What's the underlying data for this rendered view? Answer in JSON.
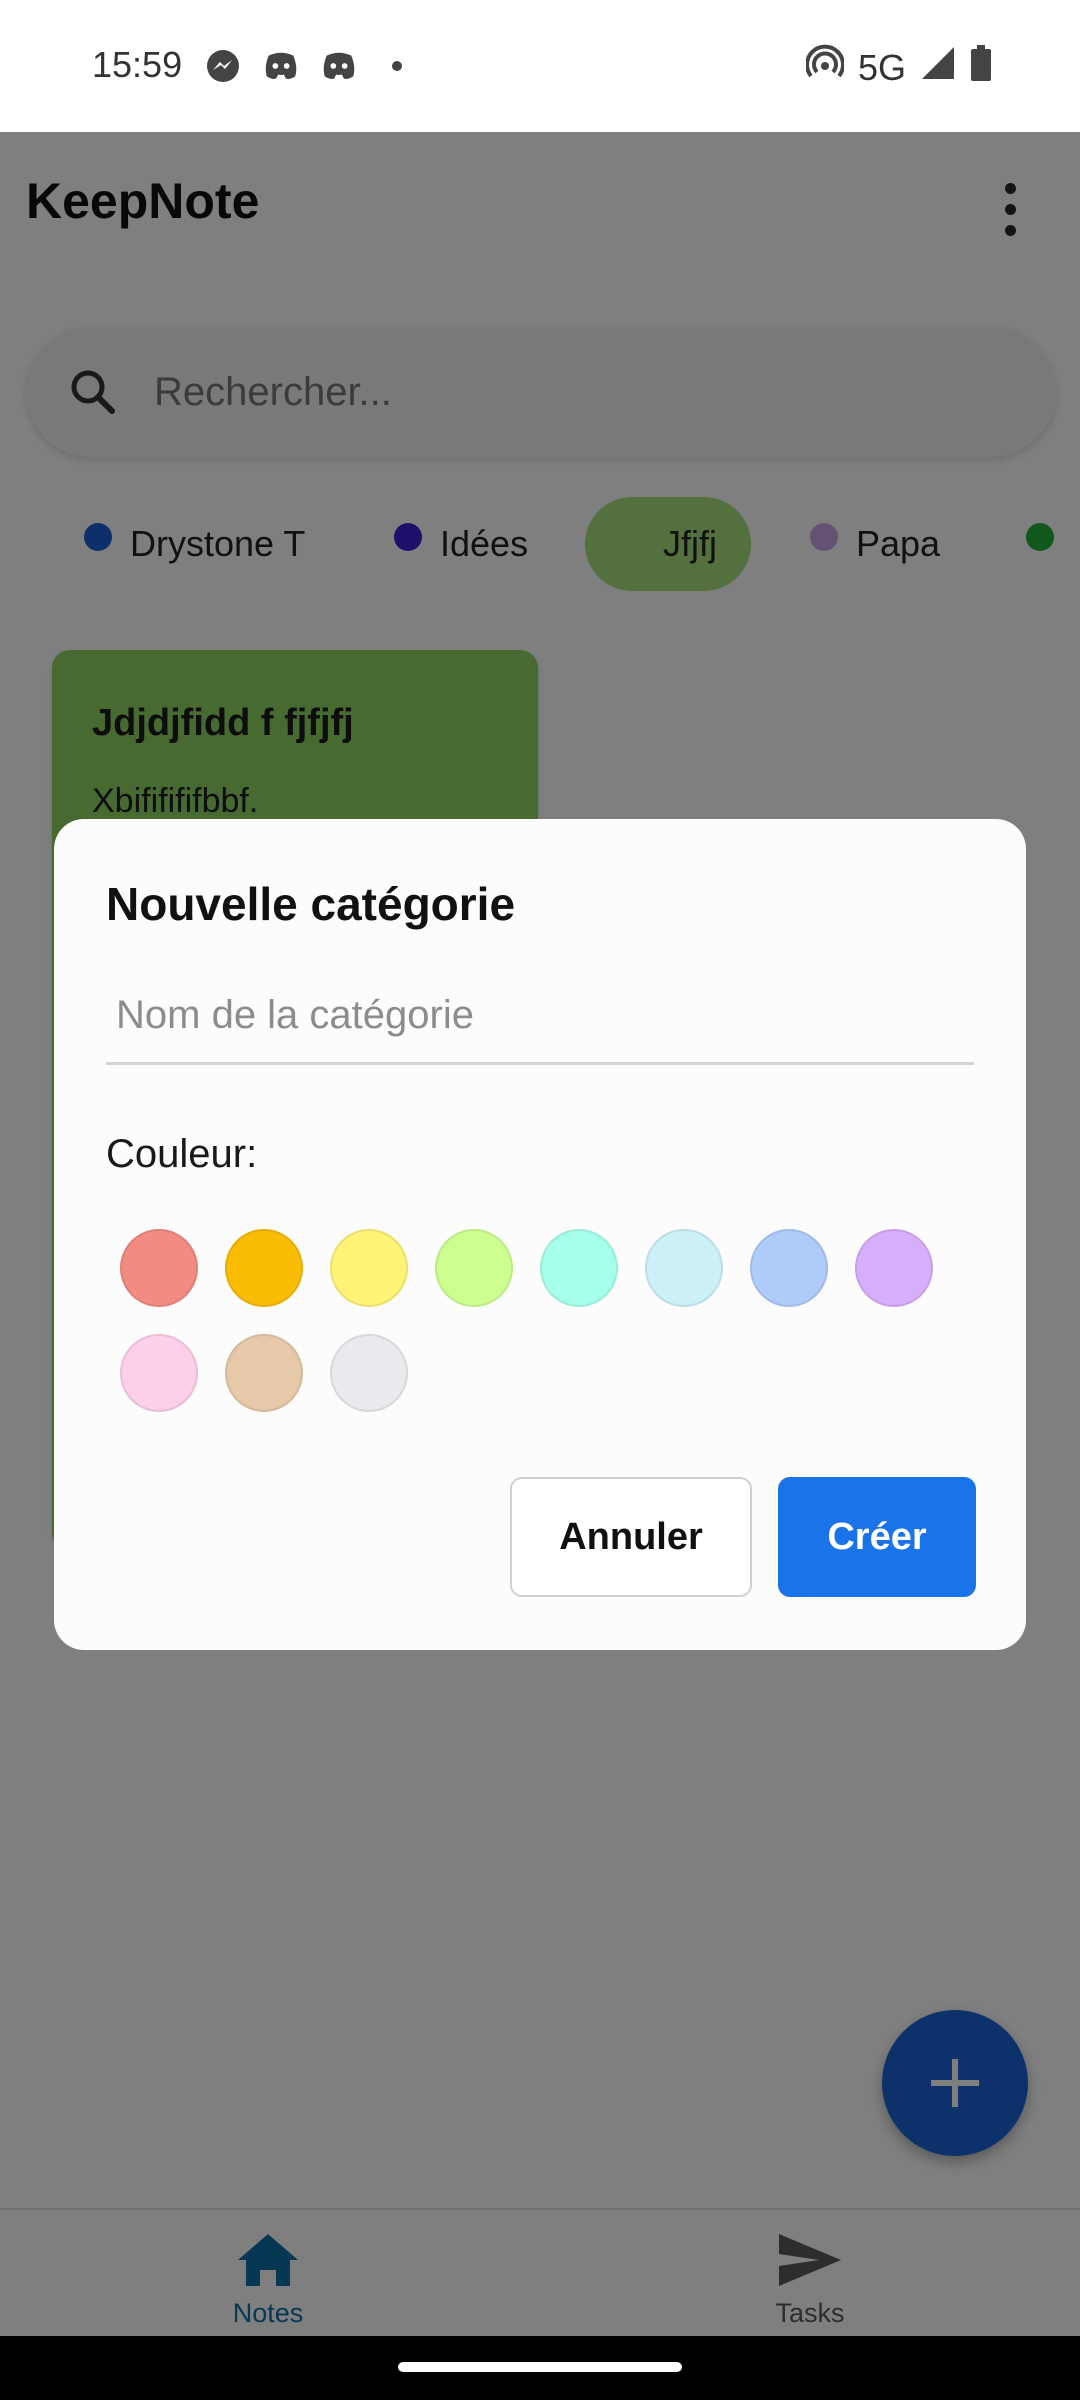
{
  "status_bar": {
    "time": "15:59",
    "network": "5G",
    "icons_left": [
      "messenger-icon",
      "discord-icon",
      "discord-icon",
      "dot-icon"
    ],
    "icons_right": [
      "hotspot-icon",
      "signal-icon",
      "battery-icon"
    ]
  },
  "app": {
    "title": "KeepNote",
    "search_placeholder": "Rechercher...",
    "categories": [
      {
        "label": "Drystone T",
        "color": "#1a5fd6",
        "selected": false
      },
      {
        "label": "Idées",
        "color": "#3d1fd6",
        "selected": false
      },
      {
        "label": "Jfjfj",
        "color": "#a8e07c",
        "selected": true
      },
      {
        "label": "Papa",
        "color": "#c9a3e8",
        "selected": false
      },
      {
        "label": "",
        "color": "#22b33a",
        "selected": false
      }
    ],
    "note": {
      "title": "Jdjdjfidd f fjfjfj",
      "body": "Xbififififbbf.",
      "color": "#8fd463"
    },
    "bottom_nav": {
      "notes_label": "Notes",
      "tasks_label": "Tasks",
      "active": "Notes",
      "active_color": "#0d6fa6"
    }
  },
  "dialog": {
    "title": "Nouvelle catégorie",
    "name_placeholder": "Nom de la catégorie",
    "color_label": "Couleur:",
    "colors": [
      "#f28b82",
      "#fbbc04",
      "#fff475",
      "#ccff90",
      "#a7ffeb",
      "#cbf0f8",
      "#aecbfa",
      "#d7aefb",
      "#fdcfe8",
      "#e6c9a8",
      "#e8eaed"
    ],
    "cancel_label": "Annuler",
    "create_label": "Créer",
    "primary_color": "#1a73e8"
  }
}
